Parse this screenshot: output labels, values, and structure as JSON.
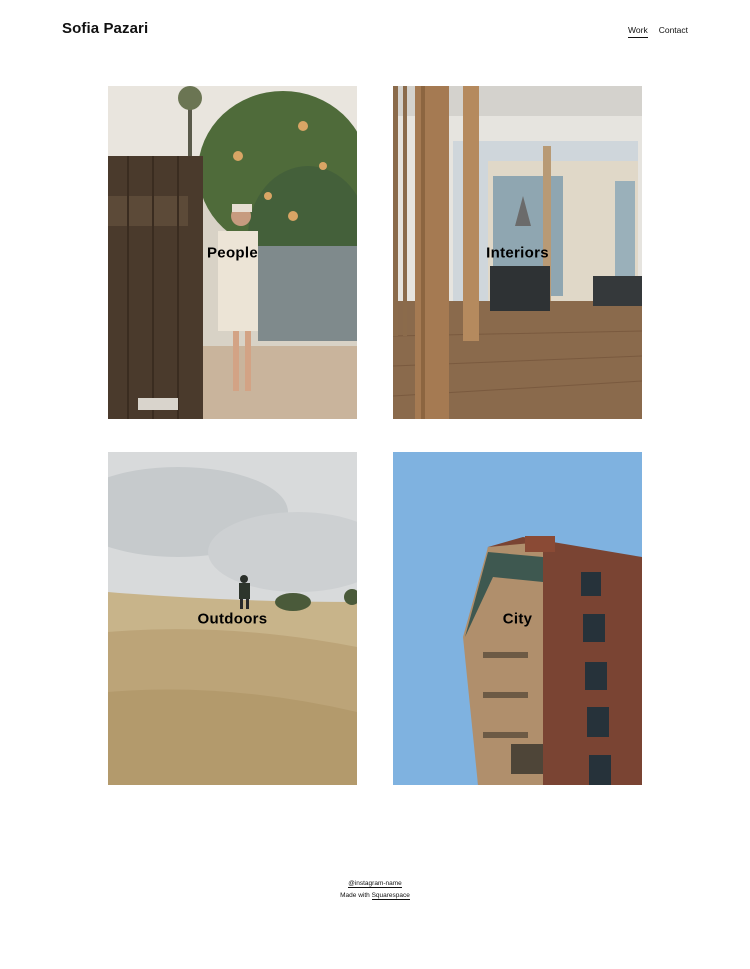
{
  "header": {
    "site_title": "Sofia Pazari",
    "nav": [
      {
        "label": "Work",
        "active": true
      },
      {
        "label": "Contact",
        "active": false
      }
    ]
  },
  "gallery": {
    "tiles": [
      {
        "label": "People",
        "image": "woman-by-wooden-fence-photo"
      },
      {
        "label": "Interiors",
        "image": "modern-interior-wood-columns-photo"
      },
      {
        "label": "Outdoors",
        "image": "person-in-grass-field-photo"
      },
      {
        "label": "City",
        "image": "brick-building-blue-sky-photo"
      }
    ]
  },
  "footer": {
    "instagram": "@instagram-name",
    "made_with_prefix": "Made with",
    "made_with_link": "Squarespace"
  },
  "colors": {
    "background": "#ffffff",
    "text": "#111111",
    "sky_blue": "#7fb2e0"
  }
}
